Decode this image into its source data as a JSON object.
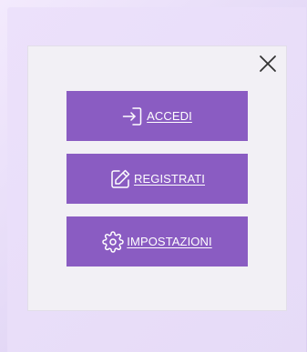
{
  "colors": {
    "button_bg": "#8a5cc2",
    "button_text": "#ffffff",
    "dialog_bg": "#f2f0f5",
    "close_icon": "#333333"
  },
  "dialog": {
    "close_icon": "close-icon",
    "buttons": [
      {
        "id": "login",
        "label": "ACCEDI",
        "icon": "login-icon"
      },
      {
        "id": "register",
        "label": "REGISTRATI",
        "icon": "edit-icon"
      },
      {
        "id": "settings",
        "label": "IMPOSTAZIONI",
        "icon": "gear-icon"
      }
    ]
  }
}
